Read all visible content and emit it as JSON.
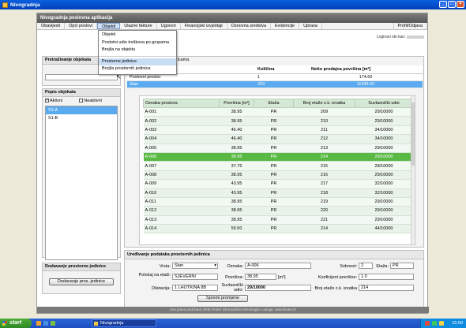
{
  "window": {
    "title": "Nivogradnja",
    "buttons": [
      "_",
      "□",
      "×"
    ]
  },
  "app": {
    "title": "Nivogradnja poslovna aplikacija",
    "menu": [
      "Obavijesti",
      "Opći poslovi",
      "Objekti",
      "Ulazne fakture",
      "Ugovori",
      "Financijski izvještaji",
      "Osnovna sredstva",
      "Evidencije",
      "Uprava"
    ],
    "menu_right": "Profil/Odjava",
    "dropdown": [
      "Objekti",
      "Postotni udio troškova po grupama",
      "Brojila na objektu",
      "Prostorne jedinice",
      "Brojila prostornih jedinica"
    ],
    "logged_in_label": "Logirani ste kao:",
    "footer": "Sva prava pridržana 2008 Finder informatičke tehnologije i usluge, www.finder.hr"
  },
  "left": {
    "search_title": "Pretraživanje objekata",
    "list_title": "Popis objekata",
    "active_label": "Aktivni",
    "inactive_label": "Neaktivni",
    "objects": [
      "S1-A",
      "S1-B"
    ],
    "add_title": "Dodavanje prostorne jedinice",
    "add_button": "Dodavanje pros. jedinice"
  },
  "main": {
    "tab_title": "...icama",
    "summary_headers": [
      "",
      "Količina",
      "Netto prodajna površina [m²]"
    ],
    "summary_rows": [
      [
        "Poslovni prostor",
        "1",
        "174.60"
      ],
      [
        "Stan",
        "253",
        "11439.60"
      ]
    ],
    "units_headers": [
      "Oznaka prostora",
      "Površina [m²]",
      "Etaža",
      "Broj etaže z.k. izvatka",
      "Suvlasnički udio"
    ],
    "units": [
      [
        "A-001",
        "38.95",
        "PR",
        "209",
        "29/10000"
      ],
      [
        "A-002",
        "38.95",
        "PR",
        "210",
        "29/10000"
      ],
      [
        "A-003",
        "46.40",
        "PR",
        "211",
        "34/10000"
      ],
      [
        "A-004",
        "46.40",
        "PR",
        "212",
        "34/10000"
      ],
      [
        "A-005",
        "38.95",
        "PR",
        "213",
        "29/10000"
      ],
      [
        "A-006",
        "38.95",
        "PR",
        "214",
        "29/10000"
      ],
      [
        "A-007",
        "37.75",
        "PR",
        "215",
        "28/10000"
      ],
      [
        "A-008",
        "38.95",
        "PR",
        "216",
        "29/10000"
      ],
      [
        "A-009",
        "43.95",
        "PR",
        "217",
        "32/10000"
      ],
      [
        "A-010",
        "43.95",
        "PR",
        "218",
        "32/10000"
      ],
      [
        "A-011",
        "38.95",
        "PR",
        "219",
        "29/10000"
      ],
      [
        "A-012",
        "38.95",
        "PR",
        "220",
        "29/10000"
      ],
      [
        "A-013",
        "38.95",
        "PR",
        "221",
        "29/10000"
      ],
      [
        "A-014",
        "59.50",
        "PR",
        "214",
        "44/10000"
      ]
    ],
    "highlight_row": 5
  },
  "edit": {
    "title": "Uređivanje podataka prostornih jedinica",
    "vrsta_label": "Vrsta:",
    "vrsta_value": "Stan",
    "oznaka_label": "Oznaka:",
    "oznaka_value": "A-006",
    "sobnost_label": "Sobnost:",
    "sobnost_value": "2",
    "etaza_label": "Etaža:",
    "etaza_value": "PR",
    "polozaj_label": "Položaj na etaži:",
    "polozaj_value": "SJEVERNI",
    "povrsina_label": "Površina:",
    "povrsina_value": "38.95",
    "povrsina_unit": "[m²]",
    "koef_label": "Koeficijent površine:",
    "koef_value": "1.0",
    "diletacija_label": "Diletacija:",
    "diletacija_value": "1 LHOTKINA 8B",
    "suvl_label": "Suvlasnički udio:",
    "suvl_value": "29/10000",
    "broj_label": "Broj etaže z.k. izvatka",
    "broj_value": "214",
    "save_button": "Spremi promjene"
  },
  "taskbar": {
    "start": "start",
    "task": "Nivogradnja",
    "clock": "15:50"
  }
}
